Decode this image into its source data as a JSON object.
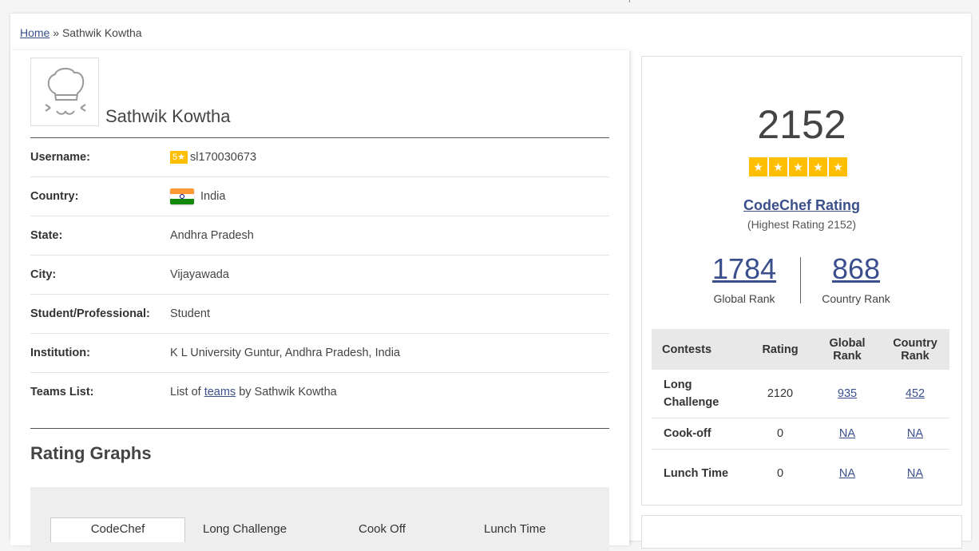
{
  "breadcrumb": {
    "home": "Home",
    "separator": "»",
    "current": "Sathwik Kowtha"
  },
  "profile": {
    "name": "Sathwik Kowtha",
    "rows": [
      {
        "label": "Username:",
        "star_badge": "5★",
        "value": "sl170030673"
      },
      {
        "label": "Country:",
        "value": "India"
      },
      {
        "label": "State:",
        "value": "Andhra Pradesh"
      },
      {
        "label": "City:",
        "value": "Vijayawada"
      },
      {
        "label": "Student/Professional:",
        "value": "Student"
      },
      {
        "label": "Institution:",
        "value": "K L University Guntur, Andhra Pradesh, India"
      },
      {
        "label": "Teams List:",
        "prefix": "List of",
        "link": "teams",
        "suffix": "by Sathwik Kowtha"
      }
    ]
  },
  "graphs": {
    "title": "Rating Graphs",
    "tabs": [
      "CodeChef",
      "Long Challenge",
      "Cook Off",
      "Lunch Time"
    ]
  },
  "rating": {
    "value": "2152",
    "stars": [
      "★",
      "★",
      "★",
      "★",
      "★"
    ],
    "link": "CodeChef Rating",
    "highest": "(Highest Rating 2152)",
    "global_rank": "1784",
    "global_rank_label": "Global Rank",
    "country_rank": "868",
    "country_rank_label": "Country Rank"
  },
  "contests": {
    "headers": [
      "Contests",
      "Rating",
      "Global Rank",
      "Country Rank"
    ],
    "rows": [
      {
        "name": "Long Challenge",
        "rating": "2120",
        "global": "935",
        "country": "452"
      },
      {
        "name": "Cook-off",
        "rating": "0",
        "global": "NA",
        "country": "NA"
      },
      {
        "name": "Lunch Time",
        "rating": "0",
        "global": "NA",
        "country": "NA"
      }
    ]
  },
  "colors": {
    "accent": "#3a4f8c",
    "star": "#ffbf00"
  }
}
